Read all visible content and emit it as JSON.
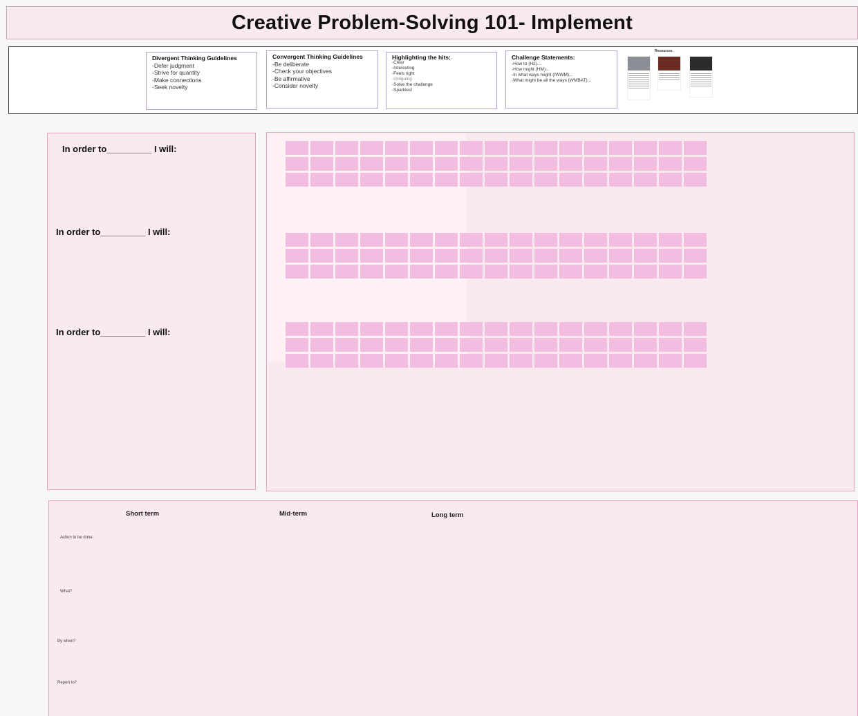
{
  "title": "Creative Problem-Solving 101- Implement",
  "guidelines": [
    {
      "title": "Divergent Thinking Guidelines",
      "items": [
        "-Defer judgment",
        "-Strive for quantity",
        "-Make connections",
        "-Seek novelty"
      ]
    },
    {
      "title": "Convergent Thinking Guidelines",
      "items": [
        "-Be deliberate",
        "-Check your objectives",
        "-Be affirmative",
        "-Consider novelty"
      ]
    },
    {
      "title": "Highlighting the hits:",
      "items": [
        "-Clear",
        "-Interesting",
        "-Feels right",
        "-Intriguing",
        "-Solve the challenge",
        "-Sparkles!"
      ]
    },
    {
      "title": "Challenge Statements:",
      "items": [
        "-How to (H2)...",
        "-How might (HM)...",
        "-In what ways might (IWWM)...",
        "-What might be all the ways (WMBAT)..."
      ]
    }
  ],
  "resources": {
    "label": "Resources"
  },
  "intentions": [
    "In order to_________ I will:",
    "In order to_________ I will:",
    "In order to_________ I will:"
  ],
  "sticky_grids": [
    {
      "rows": 3,
      "cols": 17
    },
    {
      "rows": 3,
      "cols": 17
    },
    {
      "rows": 3,
      "cols": 17
    }
  ],
  "timeline": {
    "columns": [
      "Short term",
      "Mid-term",
      "Long term"
    ],
    "rows": [
      "Action to be done:",
      "What?",
      "By when?",
      "Report to?"
    ]
  },
  "colors": {
    "panel_bg": "#fbe9f0",
    "panel_border": "#e6a3c4",
    "sticky": "#f1bde0",
    "card_border": "#b7a1d2"
  }
}
